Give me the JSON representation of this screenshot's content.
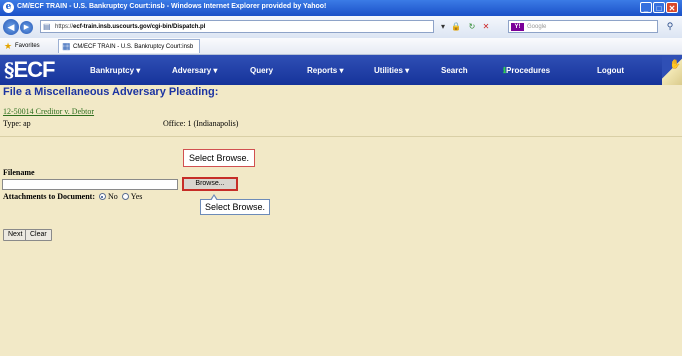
{
  "window": {
    "title": "CM/ECF TRAIN - U.S. Bankruptcy Court:insb - Windows Internet Explorer provided by Yahoo!",
    "minimize": "_",
    "maximize": "□",
    "close": "✕"
  },
  "address_bar": {
    "url_prefix": "https://",
    "url_host": "ecf-train.insb.uscourts.gov/cgi-bin/Dispatch.pl",
    "url_rest": "",
    "search_placeholder": "Google"
  },
  "favorites_bar": {
    "favorites_label": "Favorites",
    "tab_label": "CM/ECF TRAIN - U.S. Bankruptcy Court:insb"
  },
  "ecf_menu": {
    "logo": "ECF",
    "items": [
      {
        "label": "Bankruptcy ▾"
      },
      {
        "label": "Adversary ▾"
      },
      {
        "label": "Query"
      },
      {
        "label": "Reports ▾"
      },
      {
        "label": "Utilities ▾"
      },
      {
        "label": "Search"
      },
      {
        "label": "Procedures"
      },
      {
        "label": "Logout"
      }
    ]
  },
  "form": {
    "page_title": "File a Miscellaneous Adversary Pleading:",
    "case_link": "12-50014 Creditor v. Debtor",
    "type": "Type: ap",
    "office": "Office: 1 (Indianapolis)",
    "filename_label": "Filename",
    "filename_value": "",
    "browse_label": "Browse...",
    "attachments_label": "Attachments to Document:",
    "radio_no": "No",
    "radio_yes": "Yes",
    "selected": "No",
    "next_label": "Next",
    "clear_label": "Clear"
  },
  "callouts": {
    "top": "Select Browse.",
    "tip": "Select Browse."
  }
}
